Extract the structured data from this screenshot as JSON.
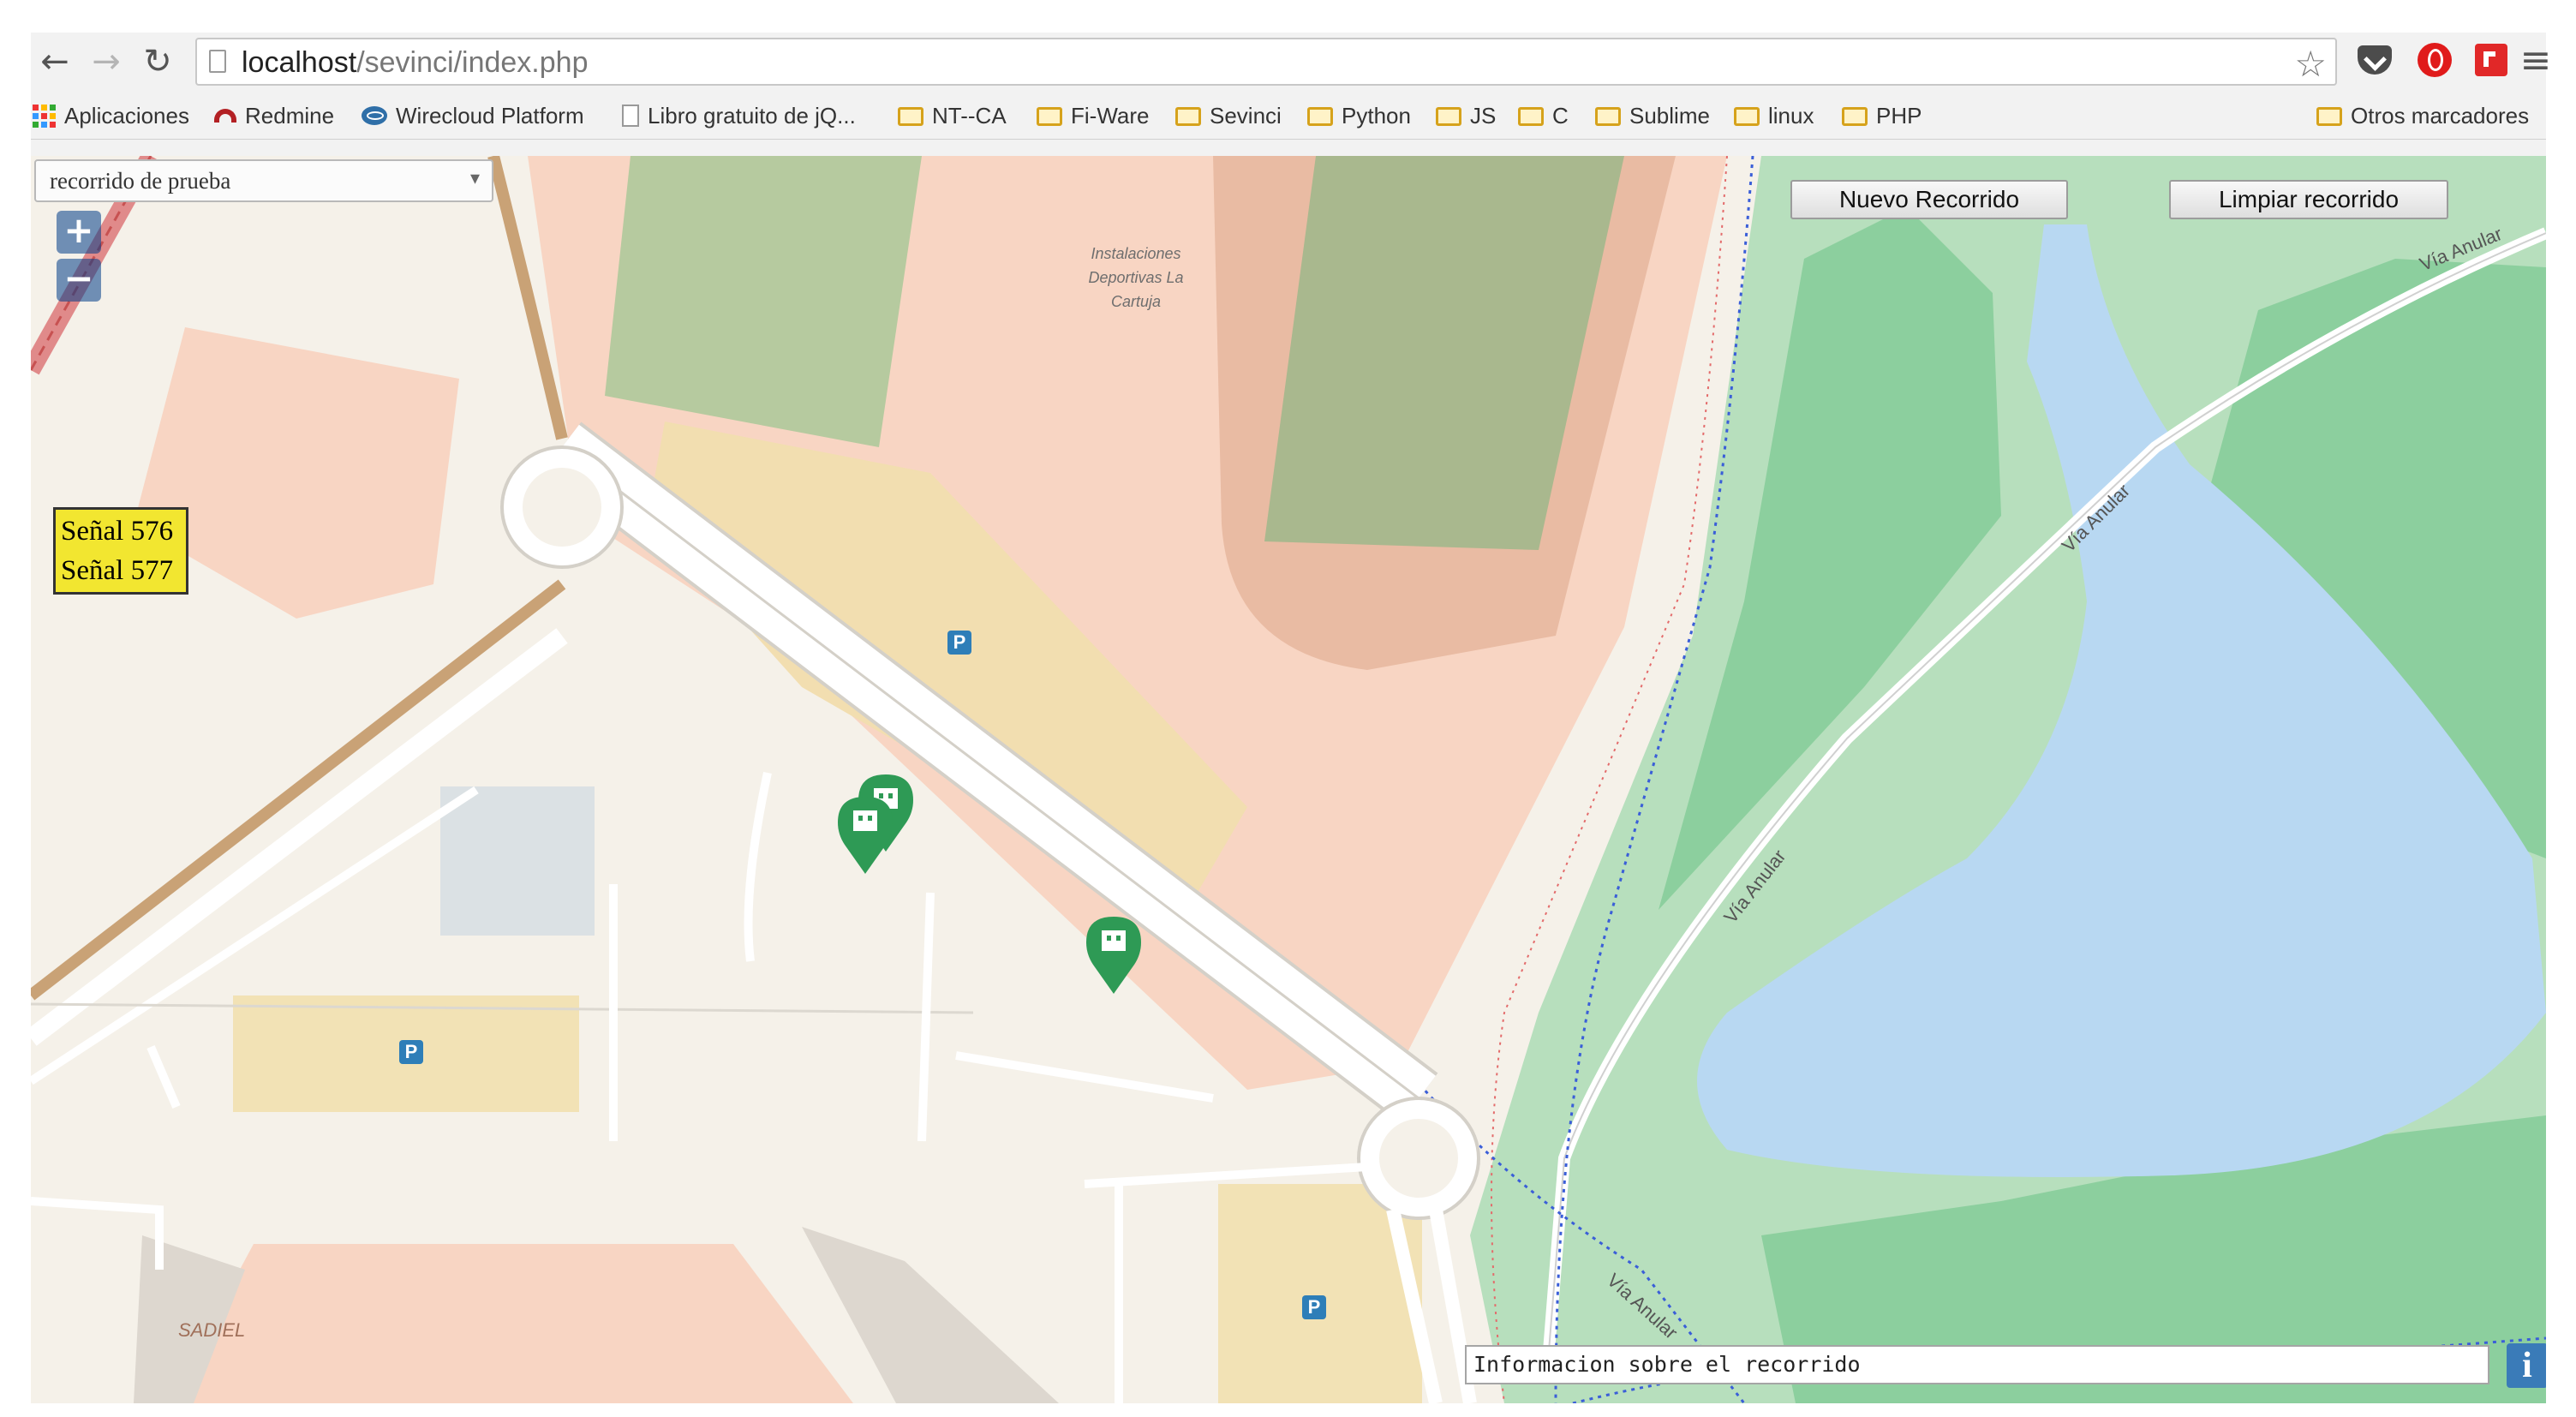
{
  "browser": {
    "url_host": "localhost",
    "url_path": "/sevinci/index.php",
    "icons": [
      "back-icon",
      "forward-icon",
      "reload-icon",
      "star-icon",
      "pocket-icon",
      "opera-icon",
      "flipboard-icon",
      "menu-icon"
    ]
  },
  "bookmarks": {
    "items": [
      "Aplicaciones",
      "Redmine",
      "Wirecloud Platform",
      "Libro gratuito de jQ...",
      "NT--CA",
      "Fi-Ware",
      "Sevinci",
      "Python",
      "JS",
      "C",
      "Sublime",
      "linux",
      "PHP"
    ],
    "other": "Otros marcadores"
  },
  "map": {
    "route_select": {
      "value": "recorrido de prueba"
    },
    "zoom_in": "+",
    "zoom_out": "−",
    "buttons": {
      "new_route": "Nuevo Recorrido",
      "clear_route": "Limpiar recorrido"
    },
    "signals": [
      "Señal 576",
      "Señal 577"
    ],
    "labels": {
      "installation": [
        "Instalaciones",
        "Deportivas La",
        "Cartuja"
      ],
      "via_anular": "Vía Anular",
      "sadiel": "SADIEL",
      "parking": "P"
    },
    "info_text": "Informacion sobre el recorrido",
    "info_button": "i",
    "colors": {
      "land": "#f5f1e9",
      "stadium": "#f8d5c3",
      "pitch": "#a9c49e",
      "parking_area": "#f2e2b5",
      "water": "#b8d8f2",
      "park": "#b7dfbd",
      "forest": "#8ccf9e",
      "marker": "#2e9a55",
      "signal_box": "#f2e630"
    }
  }
}
